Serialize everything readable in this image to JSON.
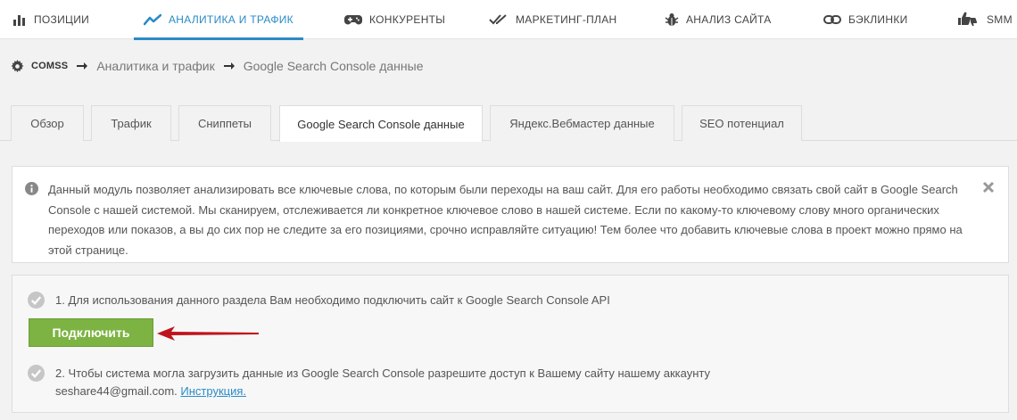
{
  "nav": {
    "items": [
      {
        "label": "Позиции",
        "icon": "bar-chart-icon"
      },
      {
        "label": "Аналитика и трафик",
        "icon": "trend-line-icon",
        "active": true
      },
      {
        "label": "Конкуренты",
        "icon": "gamepad-icon"
      },
      {
        "label": "Маркетинг-план",
        "icon": "double-check-icon"
      },
      {
        "label": "Анализ сайта",
        "icon": "bug-icon"
      },
      {
        "label": "Бэклинки",
        "icon": "link-icon"
      },
      {
        "label": "SMM",
        "icon": "thumbs-icon"
      }
    ],
    "accent_color": "#2a8bc7"
  },
  "breadcrumb": {
    "root": "COMSS",
    "items": [
      "Аналитика и трафик",
      "Google Search Console данные"
    ]
  },
  "tabs": [
    {
      "label": "Обзор"
    },
    {
      "label": "Трафик"
    },
    {
      "label": "Сниппеты"
    },
    {
      "label": "Google Search Console данные",
      "active": true
    },
    {
      "label": "Яндекс.Вебмастер данные"
    },
    {
      "label": "SEO потенциал"
    }
  ],
  "info": {
    "text": "Данный модуль позволяет анализировать все ключевые слова, по которым были переходы на ваш сайт. Для его работы необходимо связать свой сайт в Google Search Console с нашей системой. Мы сканируем, отслеживается ли конкретное ключевое слово в нашей системе. Если по какому-то ключевому слову много органических переходов или показов, а вы до сих пор не следите за его позициями, срочно исправляйте ситуацию! Тем более что добавить ключевые слова в проект можно прямо на этой странице."
  },
  "steps": {
    "step1": "1. Для использования данного раздела Вам необходимо подключить сайт к Google Search Console API",
    "connect_label": "Подключить",
    "step2": "2. Чтобы система могла загрузить данные из Google Search Console разрешите доступ к Вашему сайту нашему аккаунту",
    "email": "seshare44@gmail.com.",
    "instruction_label": "Инструкция.",
    "button_color": "#7cb342",
    "arrow_color": "#c0141c"
  }
}
